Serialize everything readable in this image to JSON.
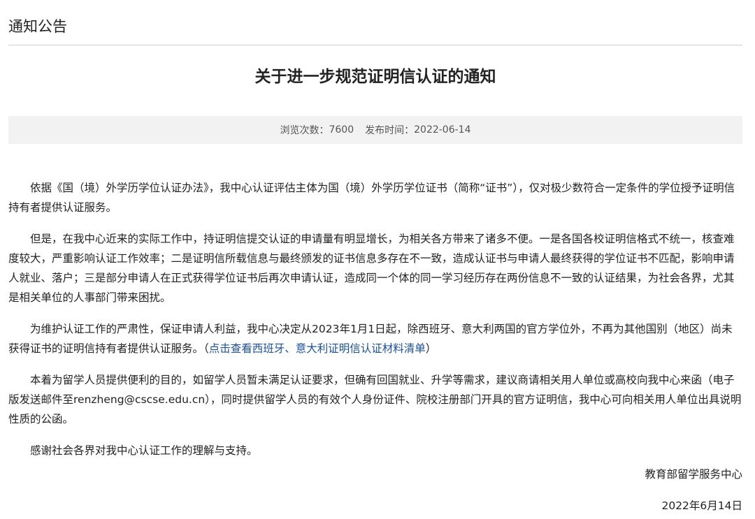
{
  "section": {
    "title": "通知公告"
  },
  "article": {
    "title": "关于进一步规范证明信认证的通知",
    "views_label": "浏览次数：",
    "views": "7600",
    "published_label": "发布时间：",
    "published": "2022-06-14",
    "paragraphs": [
      "依据《国（境）外学历学位认证办法》，我中心认证评估主体为国（境）外学历学位证书（简称“证书”），仅对极少数符合一定条件的学位授予证明信持有者提供认证服务。",
      "但是，在我中心近来的实际工作中，持证明信提交认证的申请量有明显增长，为相关各方带来了诸多不便。一是各国各校证明信格式不统一，核查难度较大，严重影响认证工作效率；二是证明信所载信息与最终颁发的证书信息多存在不一致，造成认证书与申请人最终获得的学位证书不匹配，影响申请人就业、落户；三是部分申请人在正式获得学位证书后再次申请认证，造成同一个体的同一学习经历存在两份信息不一致的认证结果，为社会各界，尤其是相关单位的人事部门带来困扰。"
    ],
    "para3_text": "为维护认证工作的严肃性，保证申请人利益，我中心决定从2023年1月1日起，除西班牙、意大利两国的官方学位外，不再为其他国别（地区）尚未获得证书的证明信持有者提供认证服务。（",
    "para3_link": "点击查看西班牙、意大利证明信认证材料清单",
    "para3_end": "）",
    "para4": "本着为留学人员提供便利的目的，如留学人员暂未满足认证要求，但确有回国就业、升学等需求，建议商请相关用人单位或高校向我中心来函（电子版发送邮件至renzheng@cscse.edu.cn），同时提供留学人员的有效个人身份证件、院校注册部门开具的官方证明信，我中心可向相关用人单位出具说明性质的公函。",
    "para5": "感谢社会各界对我中心认证工作的理解与支持。",
    "signature": "教育部留学服务中心",
    "date": "2022年6月14日"
  }
}
